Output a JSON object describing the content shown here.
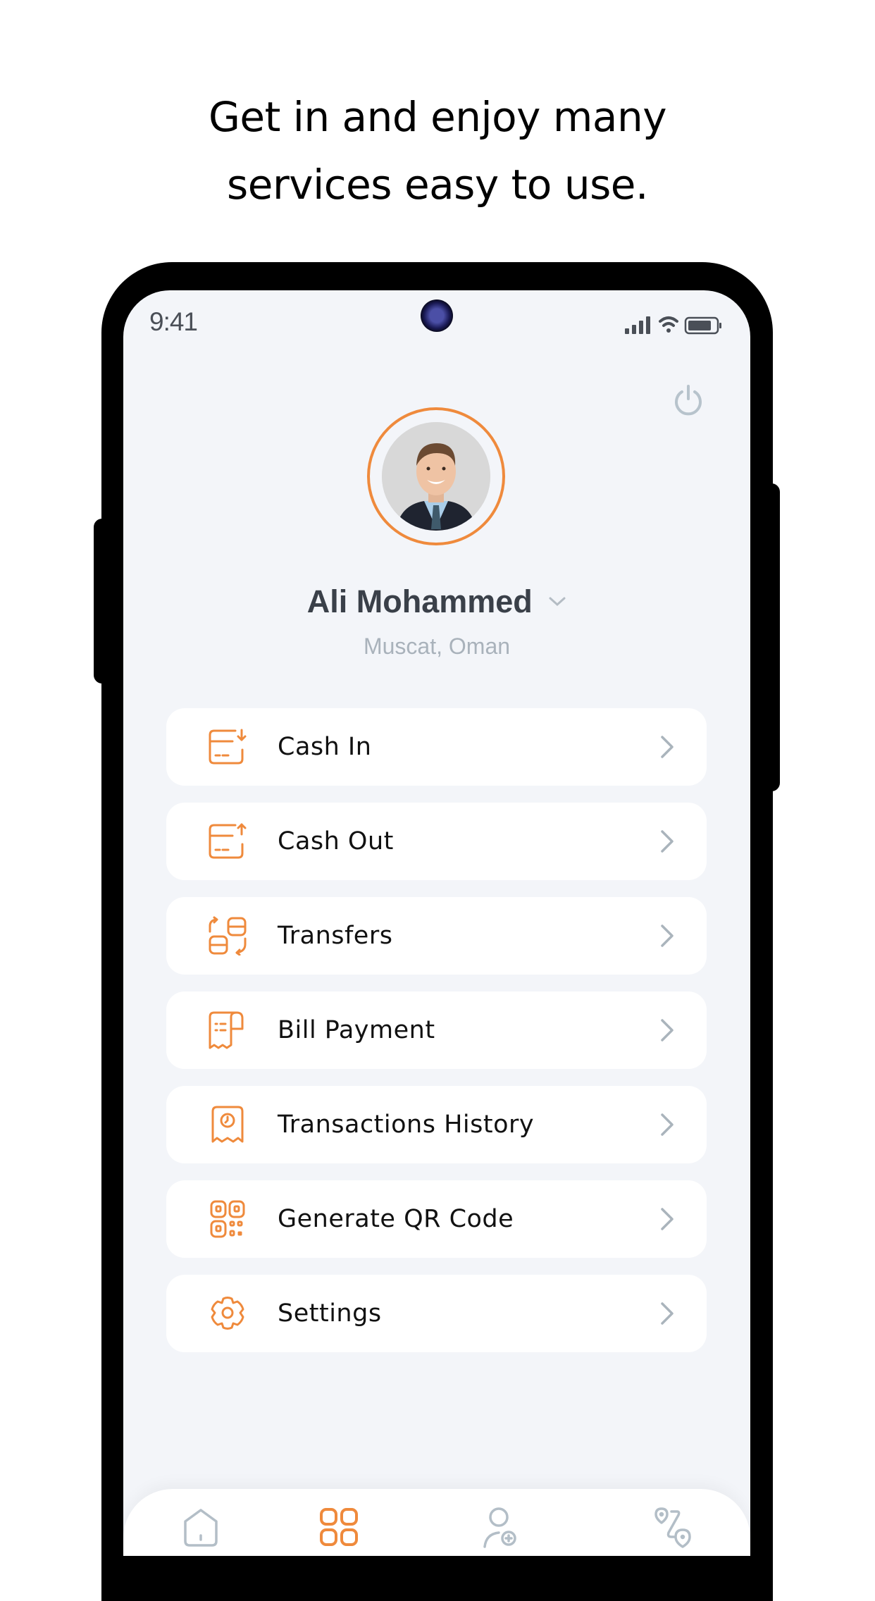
{
  "headline": {
    "line1": "Get in and enjoy many",
    "line2": "services easy to use."
  },
  "status_bar": {
    "time": "9:41",
    "icons": [
      "signal-icon",
      "wifi-icon",
      "battery-icon"
    ]
  },
  "header": {
    "power_icon": "power-icon"
  },
  "profile": {
    "name": "Ali Mohammed",
    "location": "Muscat, Oman",
    "accent_color": "#ef8a3c"
  },
  "menu": {
    "items": [
      {
        "label": "Cash In",
        "icon": "cash-in-icon"
      },
      {
        "label": "Cash Out",
        "icon": "cash-out-icon"
      },
      {
        "label": "Transfers",
        "icon": "transfers-icon"
      },
      {
        "label": "Bill Payment",
        "icon": "bill-payment-icon"
      },
      {
        "label": "Transactions History",
        "icon": "transactions-history-icon"
      },
      {
        "label": "Generate QR Code",
        "icon": "qr-code-icon"
      },
      {
        "label": "Settings",
        "icon": "settings-icon"
      }
    ]
  },
  "bottom_nav": {
    "items": [
      {
        "icon": "home-icon",
        "active": false
      },
      {
        "icon": "services-grid-icon",
        "active": true
      },
      {
        "icon": "add-user-icon",
        "active": false
      },
      {
        "icon": "route-icon",
        "active": false
      }
    ]
  },
  "colors": {
    "accent": "#ef8a3c",
    "inactive_icon": "#b3bec7",
    "screen_background": "#f3f5f9",
    "card_background": "#ffffff"
  }
}
